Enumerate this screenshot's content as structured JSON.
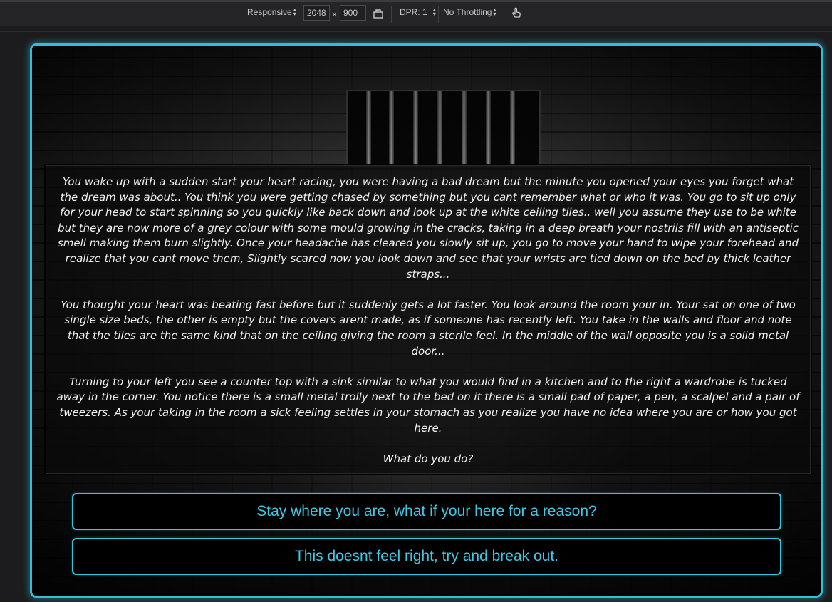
{
  "toolbar": {
    "device_label": "Responsive",
    "width_value": "2048",
    "times_symbol": "×",
    "height_value": "900",
    "dpr_label": "DPR: 1",
    "throttling_label": "No Throttling"
  },
  "story": {
    "paragraphs": [
      "You wake up with a sudden start your heart racing, you were having a bad dream but the minute you opened your eyes you forget what the dream was about.. You think you were getting chased by something but you cant remember what or who it was. You go to sit up only for your head to start spinning so you quickly like back down and look up at the white ceiling tiles.. well you assume they use to be white but they are now more of a grey colour with some mould growing in the cracks, taking in a deep breath your nostrils fill with an antiseptic smell making them burn slightly. Once your headache has cleared you slowly sit up, you go to move your hand to wipe your forehead and realize that you cant move them, Slightly scared now you look down and see that your wrists are tied down on the bed by thick leather straps...",
      "You thought your heart was beating fast before but it suddenly gets a lot faster. You look around the room your in. Your sat on one of two single size beds, the other is empty but the covers arent made, as if someone has recently left. You take in the walls and floor and note that the tiles are the same kind that on the ceiling giving the room a sterile feel. In the middle of the wall opposite you is a solid metal door...",
      "Turning to your left you see a counter top with a sink similar to what you would find in a kitchen and to the right a wardrobe is tucked away in the corner. You notice there is a small metal trolly next to the bed on it there is a small pad of paper, a pen, a scalpel and a pair of tweezers. As your taking in the room a sick feeling settles in your stomach as you realize you have no idea where you are or how you got here.",
      "What do you do?"
    ]
  },
  "choices": [
    "Stay where you are, what if your here for a reason?",
    "This doesnt feel right, try and break out."
  ],
  "colors": {
    "accent": "#2fc0d8",
    "choice_text": "#3fc9e6",
    "story_text": "#f2f2f2"
  }
}
